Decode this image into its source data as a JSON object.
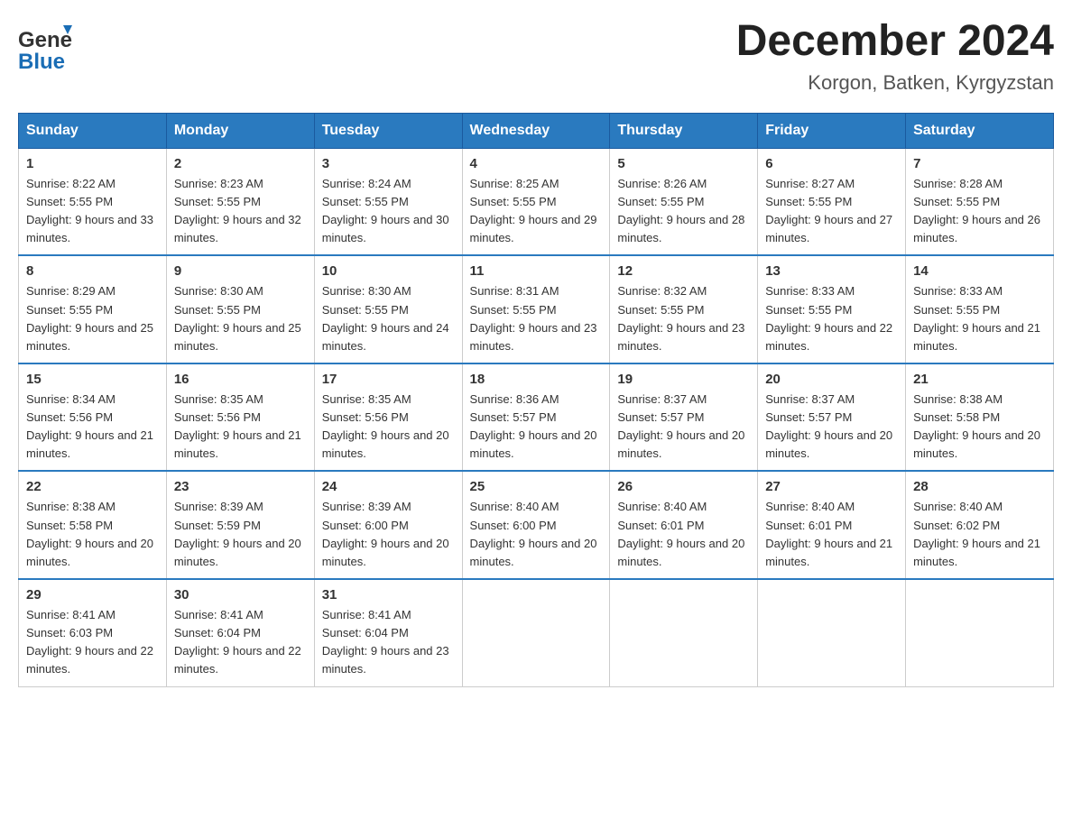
{
  "header": {
    "logo_text_general": "General",
    "logo_text_blue": "Blue",
    "month_title": "December 2024",
    "location": "Korgon, Batken, Kyrgyzstan"
  },
  "weekdays": [
    "Sunday",
    "Monday",
    "Tuesday",
    "Wednesday",
    "Thursday",
    "Friday",
    "Saturday"
  ],
  "weeks": [
    [
      {
        "day": "1",
        "sunrise": "8:22 AM",
        "sunset": "5:55 PM",
        "daylight": "9 hours and 33 minutes."
      },
      {
        "day": "2",
        "sunrise": "8:23 AM",
        "sunset": "5:55 PM",
        "daylight": "9 hours and 32 minutes."
      },
      {
        "day": "3",
        "sunrise": "8:24 AM",
        "sunset": "5:55 PM",
        "daylight": "9 hours and 30 minutes."
      },
      {
        "day": "4",
        "sunrise": "8:25 AM",
        "sunset": "5:55 PM",
        "daylight": "9 hours and 29 minutes."
      },
      {
        "day": "5",
        "sunrise": "8:26 AM",
        "sunset": "5:55 PM",
        "daylight": "9 hours and 28 minutes."
      },
      {
        "day": "6",
        "sunrise": "8:27 AM",
        "sunset": "5:55 PM",
        "daylight": "9 hours and 27 minutes."
      },
      {
        "day": "7",
        "sunrise": "8:28 AM",
        "sunset": "5:55 PM",
        "daylight": "9 hours and 26 minutes."
      }
    ],
    [
      {
        "day": "8",
        "sunrise": "8:29 AM",
        "sunset": "5:55 PM",
        "daylight": "9 hours and 25 minutes."
      },
      {
        "day": "9",
        "sunrise": "8:30 AM",
        "sunset": "5:55 PM",
        "daylight": "9 hours and 25 minutes."
      },
      {
        "day": "10",
        "sunrise": "8:30 AM",
        "sunset": "5:55 PM",
        "daylight": "9 hours and 24 minutes."
      },
      {
        "day": "11",
        "sunrise": "8:31 AM",
        "sunset": "5:55 PM",
        "daylight": "9 hours and 23 minutes."
      },
      {
        "day": "12",
        "sunrise": "8:32 AM",
        "sunset": "5:55 PM",
        "daylight": "9 hours and 23 minutes."
      },
      {
        "day": "13",
        "sunrise": "8:33 AM",
        "sunset": "5:55 PM",
        "daylight": "9 hours and 22 minutes."
      },
      {
        "day": "14",
        "sunrise": "8:33 AM",
        "sunset": "5:55 PM",
        "daylight": "9 hours and 21 minutes."
      }
    ],
    [
      {
        "day": "15",
        "sunrise": "8:34 AM",
        "sunset": "5:56 PM",
        "daylight": "9 hours and 21 minutes."
      },
      {
        "day": "16",
        "sunrise": "8:35 AM",
        "sunset": "5:56 PM",
        "daylight": "9 hours and 21 minutes."
      },
      {
        "day": "17",
        "sunrise": "8:35 AM",
        "sunset": "5:56 PM",
        "daylight": "9 hours and 20 minutes."
      },
      {
        "day": "18",
        "sunrise": "8:36 AM",
        "sunset": "5:57 PM",
        "daylight": "9 hours and 20 minutes."
      },
      {
        "day": "19",
        "sunrise": "8:37 AM",
        "sunset": "5:57 PM",
        "daylight": "9 hours and 20 minutes."
      },
      {
        "day": "20",
        "sunrise": "8:37 AM",
        "sunset": "5:57 PM",
        "daylight": "9 hours and 20 minutes."
      },
      {
        "day": "21",
        "sunrise": "8:38 AM",
        "sunset": "5:58 PM",
        "daylight": "9 hours and 20 minutes."
      }
    ],
    [
      {
        "day": "22",
        "sunrise": "8:38 AM",
        "sunset": "5:58 PM",
        "daylight": "9 hours and 20 minutes."
      },
      {
        "day": "23",
        "sunrise": "8:39 AM",
        "sunset": "5:59 PM",
        "daylight": "9 hours and 20 minutes."
      },
      {
        "day": "24",
        "sunrise": "8:39 AM",
        "sunset": "6:00 PM",
        "daylight": "9 hours and 20 minutes."
      },
      {
        "day": "25",
        "sunrise": "8:40 AM",
        "sunset": "6:00 PM",
        "daylight": "9 hours and 20 minutes."
      },
      {
        "day": "26",
        "sunrise": "8:40 AM",
        "sunset": "6:01 PM",
        "daylight": "9 hours and 20 minutes."
      },
      {
        "day": "27",
        "sunrise": "8:40 AM",
        "sunset": "6:01 PM",
        "daylight": "9 hours and 21 minutes."
      },
      {
        "day": "28",
        "sunrise": "8:40 AM",
        "sunset": "6:02 PM",
        "daylight": "9 hours and 21 minutes."
      }
    ],
    [
      {
        "day": "29",
        "sunrise": "8:41 AM",
        "sunset": "6:03 PM",
        "daylight": "9 hours and 22 minutes."
      },
      {
        "day": "30",
        "sunrise": "8:41 AM",
        "sunset": "6:04 PM",
        "daylight": "9 hours and 22 minutes."
      },
      {
        "day": "31",
        "sunrise": "8:41 AM",
        "sunset": "6:04 PM",
        "daylight": "9 hours and 23 minutes."
      },
      null,
      null,
      null,
      null
    ]
  ]
}
